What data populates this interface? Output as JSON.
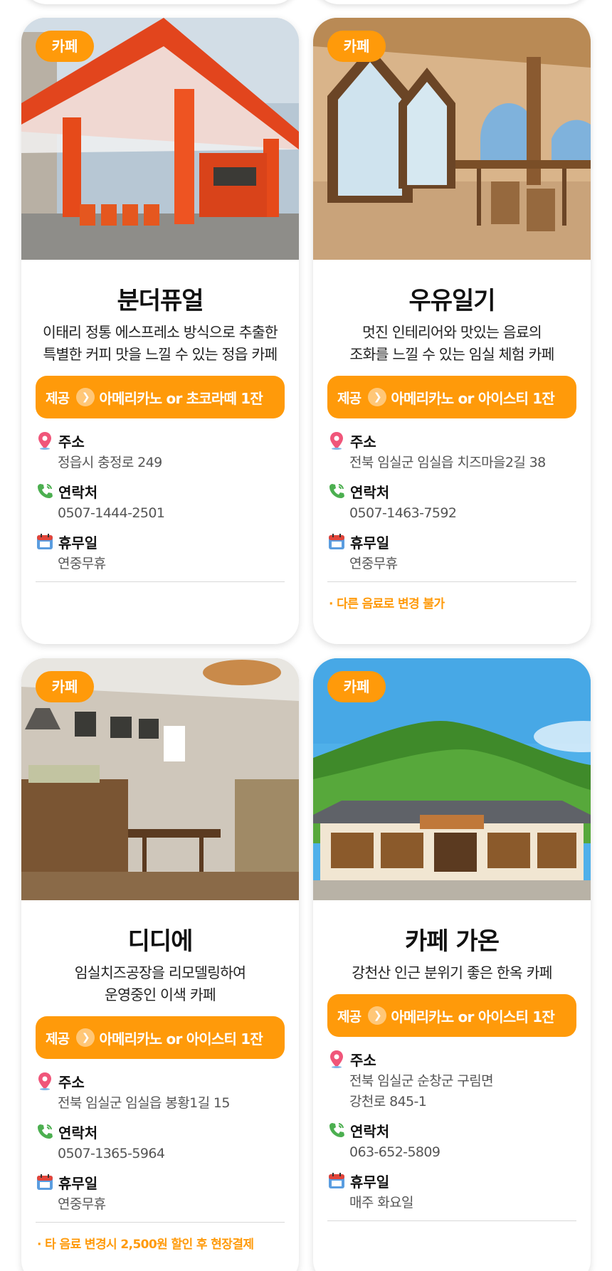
{
  "colors": {
    "accent": "#ff9a0a",
    "muted_text": "#555555",
    "divider": "#d8d8d8"
  },
  "cards": [
    {
      "category": "카페",
      "name": "분더퓨얼",
      "desc": [
        "이태리 정통 에스프레소 방식으로 추출한",
        "특별한 커피 맛을 느낄 수 있는 정읍 카페"
      ],
      "offer_label": "제공",
      "offer_text": "아메리카노 or 초코라떼 1잔",
      "address_label": "주소",
      "address": [
        "정읍시 충정로 249"
      ],
      "contact_label": "연락처",
      "contact": "0507-1444-2501",
      "closed_label": "휴무일",
      "closed": "연중무휴",
      "note": "",
      "photo_desc": "orange-gas-station-cafe"
    },
    {
      "category": "카페",
      "name": "우유일기",
      "desc": [
        "멋진 인테리어와 맛있는 음료의",
        "조화를 느낄 수 있는 임실 체험 카페"
      ],
      "offer_label": "제공",
      "offer_text": "아메리카노 or 아이스티 1잔",
      "address_label": "주소",
      "address": [
        "전북 임실군 임실읍 치즈마을2길 38"
      ],
      "contact_label": "연락처",
      "contact": "0507-1463-7592",
      "closed_label": "휴무일",
      "closed": "연중무휴",
      "note": "· 다른 음료로 변경 불가",
      "photo_desc": "wooden-interior-cafe"
    },
    {
      "category": "카페",
      "name": "디디에",
      "desc": [
        "임실치즈공장을 리모델링하여",
        "운영중인 이색 카페"
      ],
      "offer_label": "제공",
      "offer_text": "아메리카노 or 아이스티 1잔",
      "address_label": "주소",
      "address": [
        "전북 임실군 임실읍 봉황1길 15"
      ],
      "contact_label": "연락처",
      "contact": "0507-1365-5964",
      "closed_label": "휴무일",
      "closed": "연중무휴",
      "note": "· 타 음료 변경시 2,500원 할인 후 현장결제",
      "photo_desc": "vintage-interior-cafe"
    },
    {
      "category": "카페",
      "name": "카페 가온",
      "desc": [
        "강천산 인근 분위기 좋은 한옥 카페"
      ],
      "offer_label": "제공",
      "offer_text": "아메리카노 or 아이스티 1잔",
      "address_label": "주소",
      "address": [
        "전북 임실군 순창군 구림면",
        "강천로 845-1"
      ],
      "contact_label": "연락처",
      "contact": "063-652-5809",
      "closed_label": "휴무일",
      "closed": "매주 화요일",
      "note": "",
      "photo_desc": "hanok-cafe-mountain"
    }
  ]
}
